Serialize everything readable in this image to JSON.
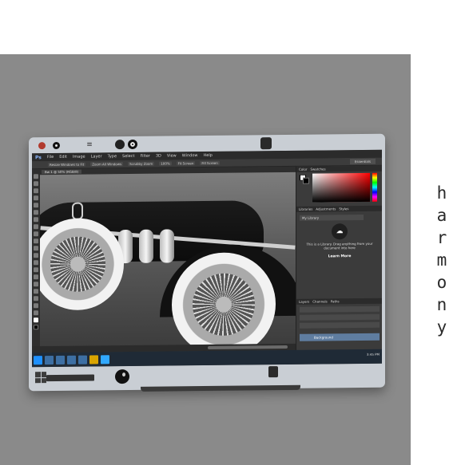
{
  "side_text": {
    "letters": [
      "h",
      "a",
      "r",
      "m",
      "o",
      "n",
      "y"
    ]
  },
  "photoshop": {
    "logo": "Ps",
    "menus": [
      "File",
      "Edit",
      "Image",
      "Layer",
      "Type",
      "Select",
      "Filter",
      "3D",
      "View",
      "Window",
      "Help"
    ],
    "options": [
      "Resize Windows to Fit",
      "Zoom All Windows",
      "Scrubby Zoom",
      "100%",
      "Fit Screen",
      "Fill Screen"
    ],
    "workspace": "Essentials",
    "doc_tab": "Bw 1 @ 50% (RGB/8)",
    "panel_tabs_color": [
      "Color",
      "Swatches"
    ],
    "panel_tabs_lib": [
      "Libraries",
      "Adjustments",
      "Styles"
    ],
    "library_dropdown": "My Library",
    "library_message": "This is a Library. Drag anything from your document into here",
    "learn_more": "Learn More",
    "panel_tabs_layers": [
      "Layers",
      "Channels",
      "Paths"
    ],
    "layer_name": "Background"
  },
  "taskbar": {
    "clock": "3:45 PM"
  },
  "colors": {
    "backdrop": "#8a8a8a",
    "tablet_frame": "#c9ced4",
    "taskbar": "#1f2a36"
  }
}
